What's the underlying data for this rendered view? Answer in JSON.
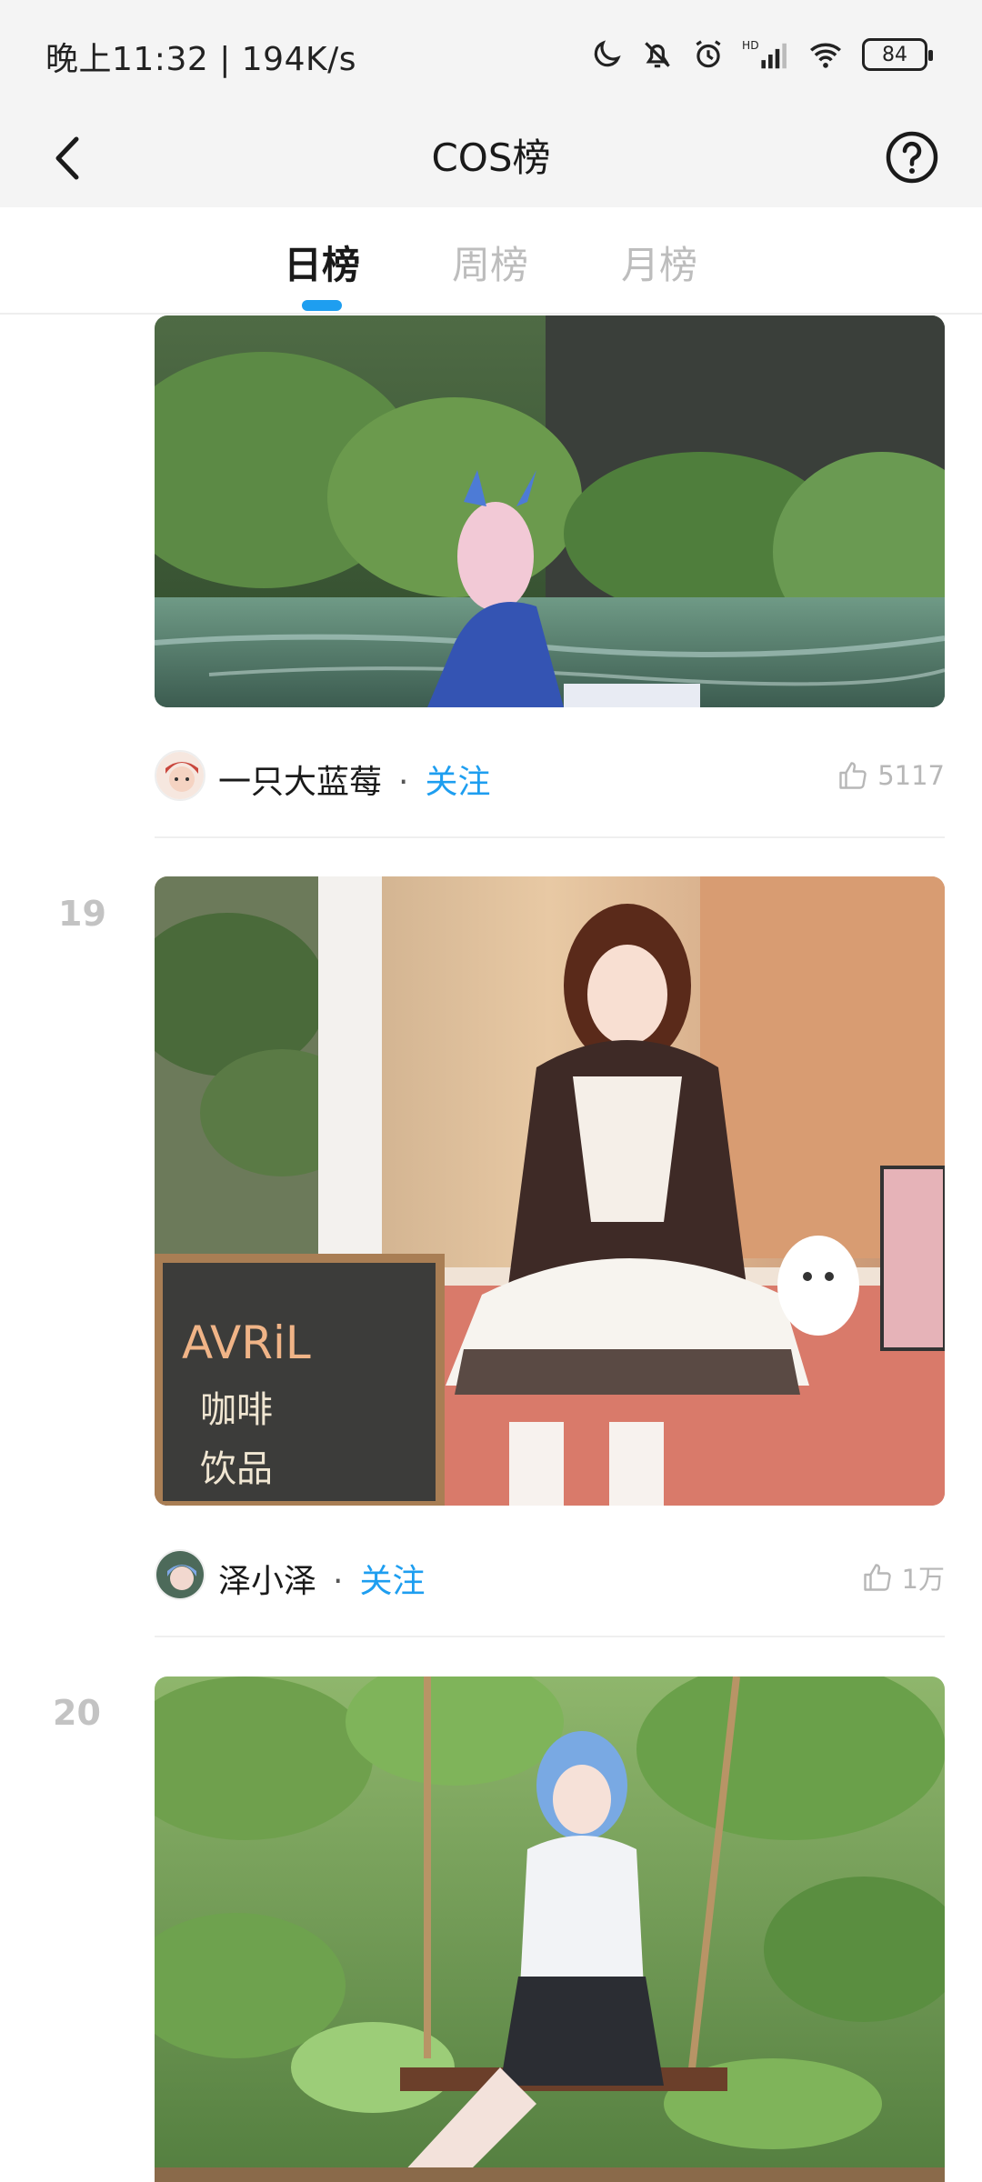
{
  "status_bar": {
    "left_text": "晚上11:32 | 194K/s",
    "battery": "84",
    "icons": [
      "moon-icon",
      "bell-off-icon",
      "alarm-icon",
      "hd-signal-icon",
      "wifi-icon",
      "battery-icon"
    ]
  },
  "header": {
    "title": "COS榜",
    "back_icon": "chevron-left-icon",
    "help_icon": "question-circle-icon"
  },
  "tabs": [
    {
      "label": "日榜",
      "active": true
    },
    {
      "label": "周榜",
      "active": false
    },
    {
      "label": "月榜",
      "active": false
    }
  ],
  "accent_color": "#1e9ef0",
  "posts": [
    {
      "rank": "",
      "author": "一只大蓝莓",
      "follow_label": "关注",
      "separator": "·",
      "likes": "5117"
    },
    {
      "rank": "19",
      "author": "泽小泽",
      "follow_label": "关注",
      "separator": "·",
      "likes": "1万"
    },
    {
      "rank": "20",
      "author": "",
      "follow_label": "",
      "separator": "",
      "likes": ""
    }
  ]
}
